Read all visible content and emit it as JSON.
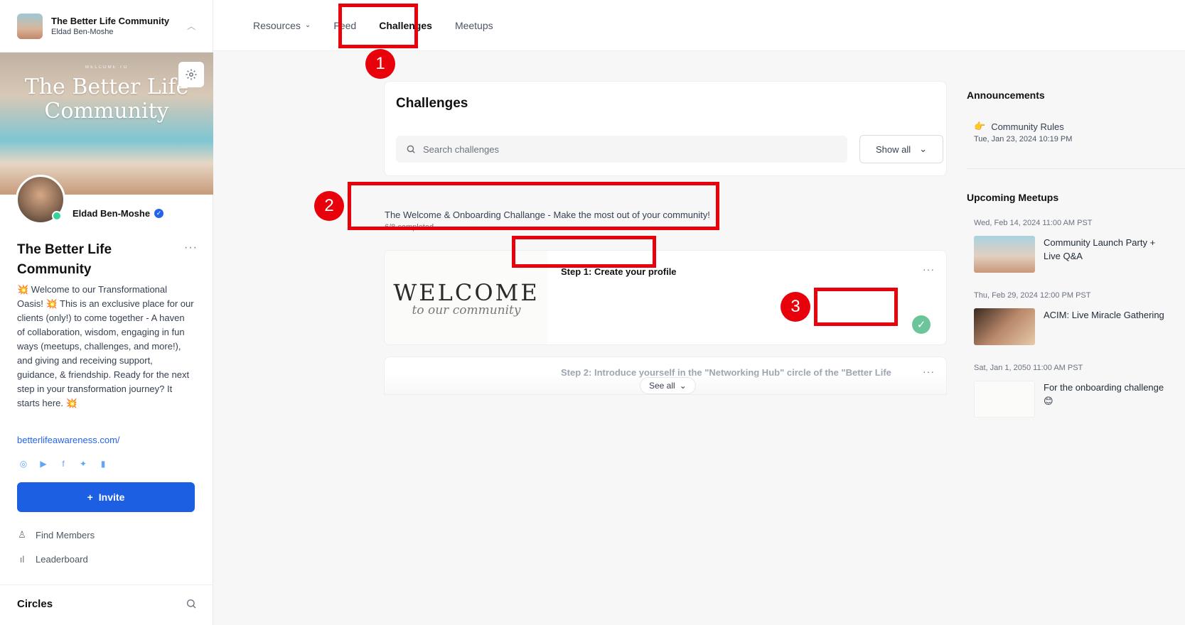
{
  "sidebar": {
    "community_title": "The Better Life Community",
    "owner_name": "Eldad Ben-Moshe",
    "banner_small": "WELCOME TO",
    "banner_title": "The Better Life Community",
    "profile_name": "Eldad Ben-Moshe",
    "community_name": "The Better Life Community",
    "description": "💥 Welcome to our Transformational Oasis! 💥 This is an exclusive place for our clients (only!) to come together - A haven of collaboration, wisdom, engaging in fun ways (meetups, challenges, and more!), and giving and receiving support, guidance, & friendship. Ready for the next step in your transformation journey? It starts here. 💥",
    "link": "betterlifeawareness.com/",
    "invite_label": "Invite",
    "find_members": "Find Members",
    "leaderboard": "Leaderboard",
    "circles": "Circles"
  },
  "nav": {
    "resources": "Resources",
    "feed": "Feed",
    "challenges": "Challenges",
    "meetups": "Meetups"
  },
  "main": {
    "title": "Challenges",
    "search_placeholder": "Search challenges",
    "filter_label": "Show all",
    "challenge_title": "The Welcome & Onboarding Challange - Make the most out of your community!",
    "challenge_progress": "6/8 completed",
    "step1_name": "Step 1: Create your profile",
    "step1_thumb_big": "WELCOME",
    "step1_thumb_script": "to our community",
    "step2_name": "Step 2: Introduce yourself in the \"Networking Hub\" circle of the \"Better Life",
    "see_all": "See all"
  },
  "right": {
    "announcements_heading": "Announcements",
    "announcement_title": "Community Rules",
    "announcement_date": "Tue, Jan 23, 2024 10:19 PM",
    "meetups_heading": "Upcoming Meetups",
    "meetups": [
      {
        "date": "Wed, Feb 14, 2024 11:00 AM PST",
        "title": "Community Launch Party + Live Q&A"
      },
      {
        "date": "Thu, Feb 29, 2024 12:00 PM PST",
        "title": "ACIM: Live Miracle Gathering"
      },
      {
        "date": "Sat, Jan 1, 2050 11:00 AM PST",
        "title": "For the onboarding challenge 😊"
      }
    ]
  },
  "annotations": {
    "badge1": "1",
    "badge2": "2",
    "badge3": "3",
    "color": "#e8000b"
  },
  "colors": {
    "accent": "#1d5fe3",
    "check": "#6cc59a"
  }
}
